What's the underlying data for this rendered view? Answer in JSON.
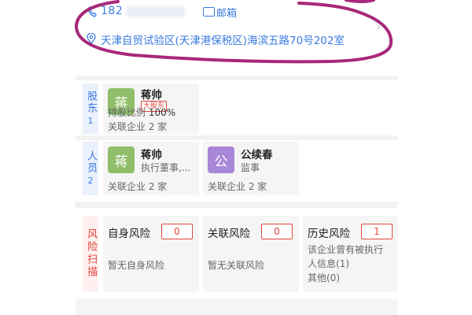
{
  "contact": {
    "phone_prefix": "182",
    "email_label": "邮箱",
    "address": "天津自贸试验区(天津港保税区)海滨五路70号202室"
  },
  "shareholders": {
    "side_label": "股东",
    "count": "1",
    "items": [
      {
        "avatar_char": "蒋",
        "name": "蒋帅",
        "badge": "大股东",
        "share_label": "持股比例 ",
        "share_value": "100%",
        "related_label": "关联企业 2 家"
      }
    ]
  },
  "personnel": {
    "side_label": "人员",
    "count": "2",
    "items": [
      {
        "avatar_char": "蒋",
        "name": "蒋帅",
        "role": "执行董事,...",
        "related_label": "关联企业 2 家"
      },
      {
        "avatar_char": "公",
        "name": "公续春",
        "role": "监事",
        "related_label": "关联企业 2 家"
      }
    ]
  },
  "risk": {
    "side_label": "风险扫描",
    "items": [
      {
        "title": "自身风险",
        "count": "0",
        "desc_lines": [
          "暂无自身风险"
        ]
      },
      {
        "title": "关联风险",
        "count": "0",
        "desc_lines": [
          "暂无关联风险"
        ]
      },
      {
        "title": "历史风险",
        "count": "1",
        "desc_lines": [
          "该企业曾有被执行",
          "人信息(1)",
          "其他(0)"
        ]
      }
    ]
  },
  "colors": {
    "accent_blue": "#3b7be0",
    "risk_red": "#e0473d",
    "annotation_magenta": "#a8287a"
  }
}
